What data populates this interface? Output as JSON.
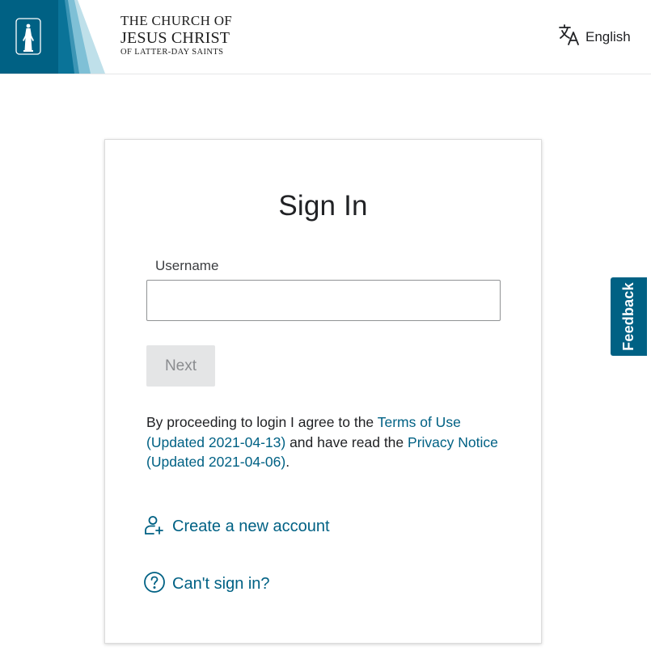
{
  "header": {
    "wordmark": {
      "line1": "THE CHURCH OF",
      "line2": "JESUS CHRIST",
      "line3": "OF LATTER-DAY SAINTS"
    },
    "language_label": "English"
  },
  "signin": {
    "title": "Sign In",
    "username_label": "Username",
    "username_value": "",
    "next_label": "Next",
    "terms_prefix": "By proceeding to login I agree to the ",
    "terms_link": "Terms of Use (Updated 2021-04-13)",
    "terms_middle": " and have read the ",
    "privacy_link": "Privacy Notice (Updated 2021-04-06)",
    "terms_suffix": ".",
    "create_account": "Create a new account",
    "cant_sign_in": "Can't sign in?"
  },
  "feedback_label": "Feedback",
  "colors": {
    "accent": "#006184",
    "logo_dark": "#006184",
    "button_disabled_bg": "#e4e5e6"
  },
  "icons": {
    "language": "translate-icon",
    "create": "add-person-icon",
    "help": "question-circle-icon",
    "logo": "christus-statue-icon"
  }
}
